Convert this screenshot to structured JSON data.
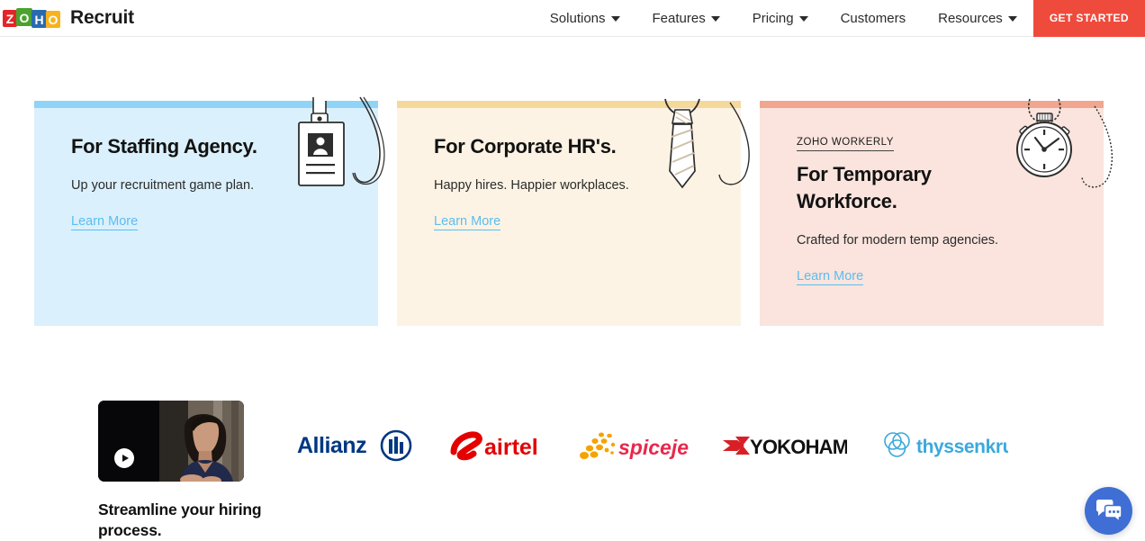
{
  "header": {
    "logo_icon": "zoho-logo",
    "brand_name": "Recruit",
    "nav_items": [
      {
        "label": "Solutions",
        "has_dropdown": true
      },
      {
        "label": "Features",
        "has_dropdown": true
      },
      {
        "label": "Pricing",
        "has_dropdown": true
      },
      {
        "label": "Customers",
        "has_dropdown": false
      },
      {
        "label": "Resources",
        "has_dropdown": true
      }
    ],
    "cta_label": "GET STARTED",
    "cta_color": "#ef4b3c"
  },
  "cards": [
    {
      "eyebrow": "",
      "title": "For Staffing Agency.",
      "subtitle": "Up your recruitment game plan.",
      "link_label": "Learn More",
      "strip_color": "#8fd4f7",
      "bg_color": "#daf0fc",
      "art_icon": "id-badge-icon"
    },
    {
      "eyebrow": "",
      "title": "For Corporate HR's.",
      "subtitle": "Happy hires. Happier workplaces.",
      "link_label": "Learn More",
      "strip_color": "#f5d99a",
      "bg_color": "#fdf3e4",
      "art_icon": "necktie-icon"
    },
    {
      "eyebrow": "ZOHO WORKERLY",
      "title": "For Temporary Workforce.",
      "subtitle": "Crafted for modern temp agencies.",
      "link_label": "Learn More",
      "strip_color": "#f0a68f",
      "bg_color": "#fae4dd",
      "art_icon": "stopwatch-icon"
    }
  ],
  "video": {
    "play_icon": "play-icon",
    "caption": "Streamline your hiring process."
  },
  "logos": [
    {
      "name": "Allianz",
      "color": "#003781"
    },
    {
      "name": "airtel",
      "color": "#e40000"
    },
    {
      "name": "spicejet",
      "color": "#e8274b"
    },
    {
      "name": "YOKOHAMA",
      "color": "#111111"
    },
    {
      "name": "thyssenkrupp",
      "color": "#3aa9dc"
    }
  ],
  "chat": {
    "icon": "chat-bubbles-icon",
    "color": "#3f6fd4"
  }
}
